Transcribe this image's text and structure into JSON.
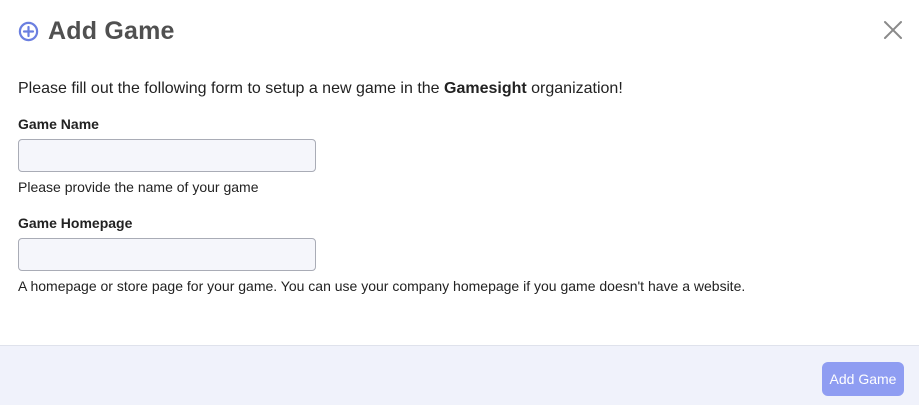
{
  "modal": {
    "title": "Add Game",
    "accent_color": "#6b7fe0"
  },
  "intro": {
    "before": "Please fill out the following form to setup a new game in the ",
    "org_name": "Gamesight",
    "after": " organization!"
  },
  "fields": {
    "game_name": {
      "label": "Game Name",
      "value": "",
      "placeholder": "",
      "help": "Please provide the name of your game"
    },
    "game_homepage": {
      "label": "Game Homepage",
      "value": "",
      "placeholder": "",
      "help": "A homepage or store page for your game. You can use your company homepage if you game doesn't have a website."
    }
  },
  "footer": {
    "submit_label": "Add Game",
    "submit_color": "#8f9df2"
  },
  "icons": {
    "title_icon": "plus-circle-icon",
    "close_icon": "close-icon"
  }
}
